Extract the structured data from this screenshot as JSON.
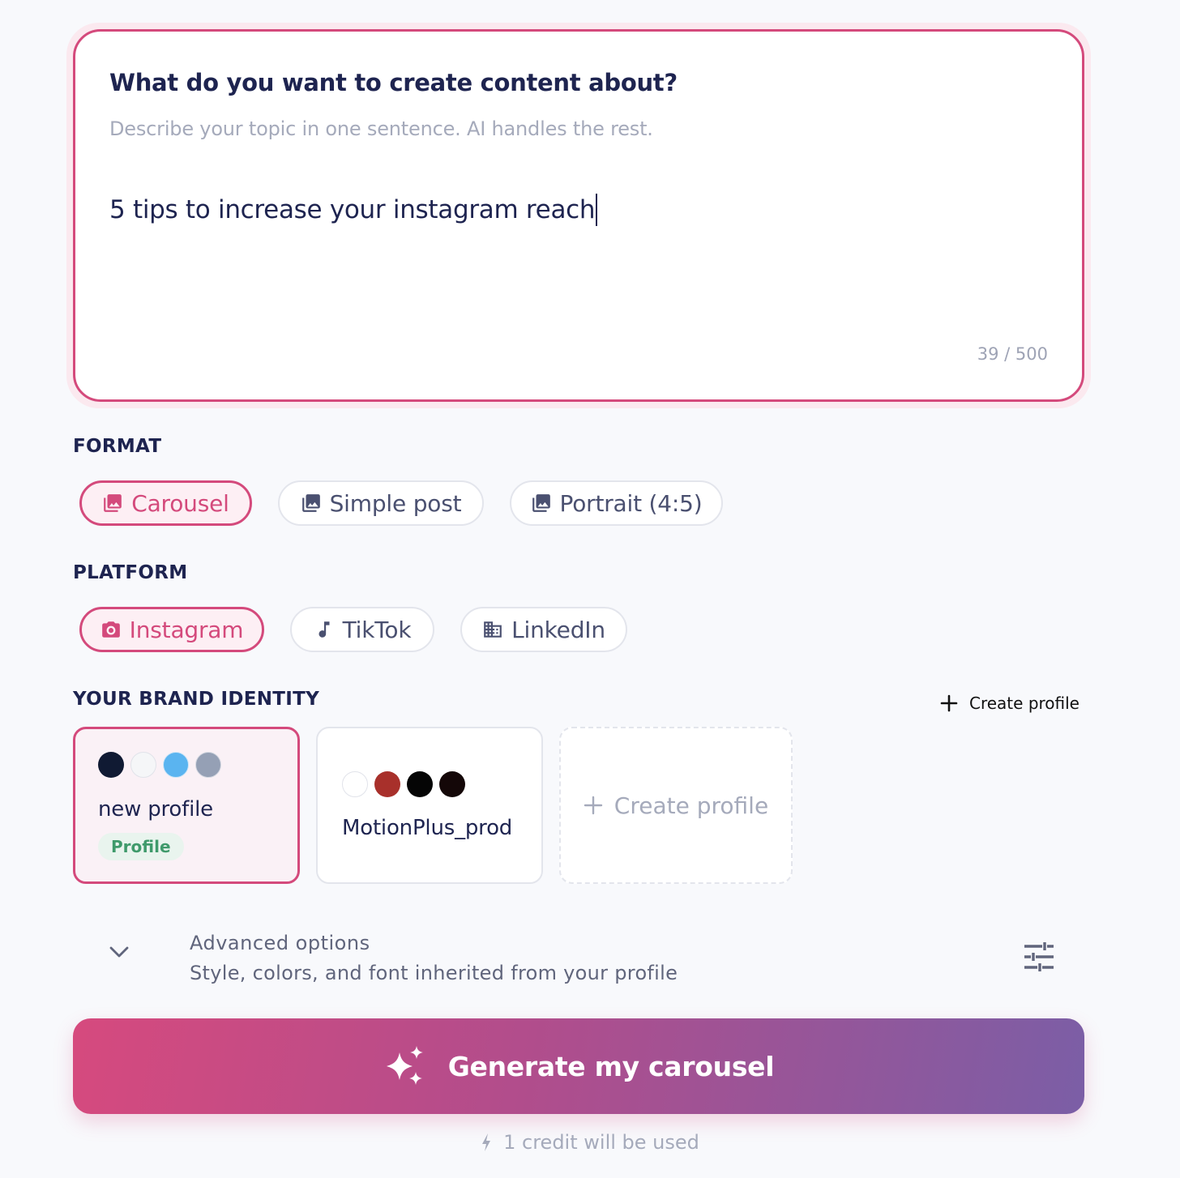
{
  "topic": {
    "title": "What do you want to create content about?",
    "subtitle": "Describe your topic in one sentence. AI handles the rest.",
    "value": "5 tips to increase your instagram reach",
    "counter": "39 / 500"
  },
  "format": {
    "label": "FORMAT",
    "options": [
      {
        "label": "Carousel",
        "icon": "images-icon",
        "selected": true
      },
      {
        "label": "Simple post",
        "icon": "images-icon",
        "selected": false
      },
      {
        "label": "Portrait (4:5)",
        "icon": "images-icon",
        "selected": false
      }
    ]
  },
  "platform": {
    "label": "PLATFORM",
    "options": [
      {
        "label": "Instagram",
        "icon": "camera-icon",
        "selected": true
      },
      {
        "label": "TikTok",
        "icon": "music-note-icon",
        "selected": false
      },
      {
        "label": "LinkedIn",
        "icon": "building-icon",
        "selected": false
      }
    ]
  },
  "brand": {
    "label": "YOUR BRAND IDENTITY",
    "create_label": "Create profile",
    "profiles": [
      {
        "name": "new profile",
        "tag": "Profile",
        "colors": [
          "#101a33",
          "#f5f6f8",
          "#5ab4f0",
          "#95a0b5"
        ],
        "selected": true
      },
      {
        "name": "MotionPlus_prod",
        "colors": [
          "#ffffff",
          "#a8302b",
          "#050505",
          "#140708"
        ],
        "selected": false
      }
    ],
    "create_card_label": "Create profile"
  },
  "advanced": {
    "title": "Advanced options",
    "subtitle": "Style, colors, and font inherited from your profile"
  },
  "generate": {
    "label": "Generate my carousel",
    "credit_note": "1 credit will be used"
  },
  "colors": {
    "accent": "#d44a7c",
    "gradient_start": "#d64a7e",
    "gradient_end": "#7b5ea6"
  }
}
